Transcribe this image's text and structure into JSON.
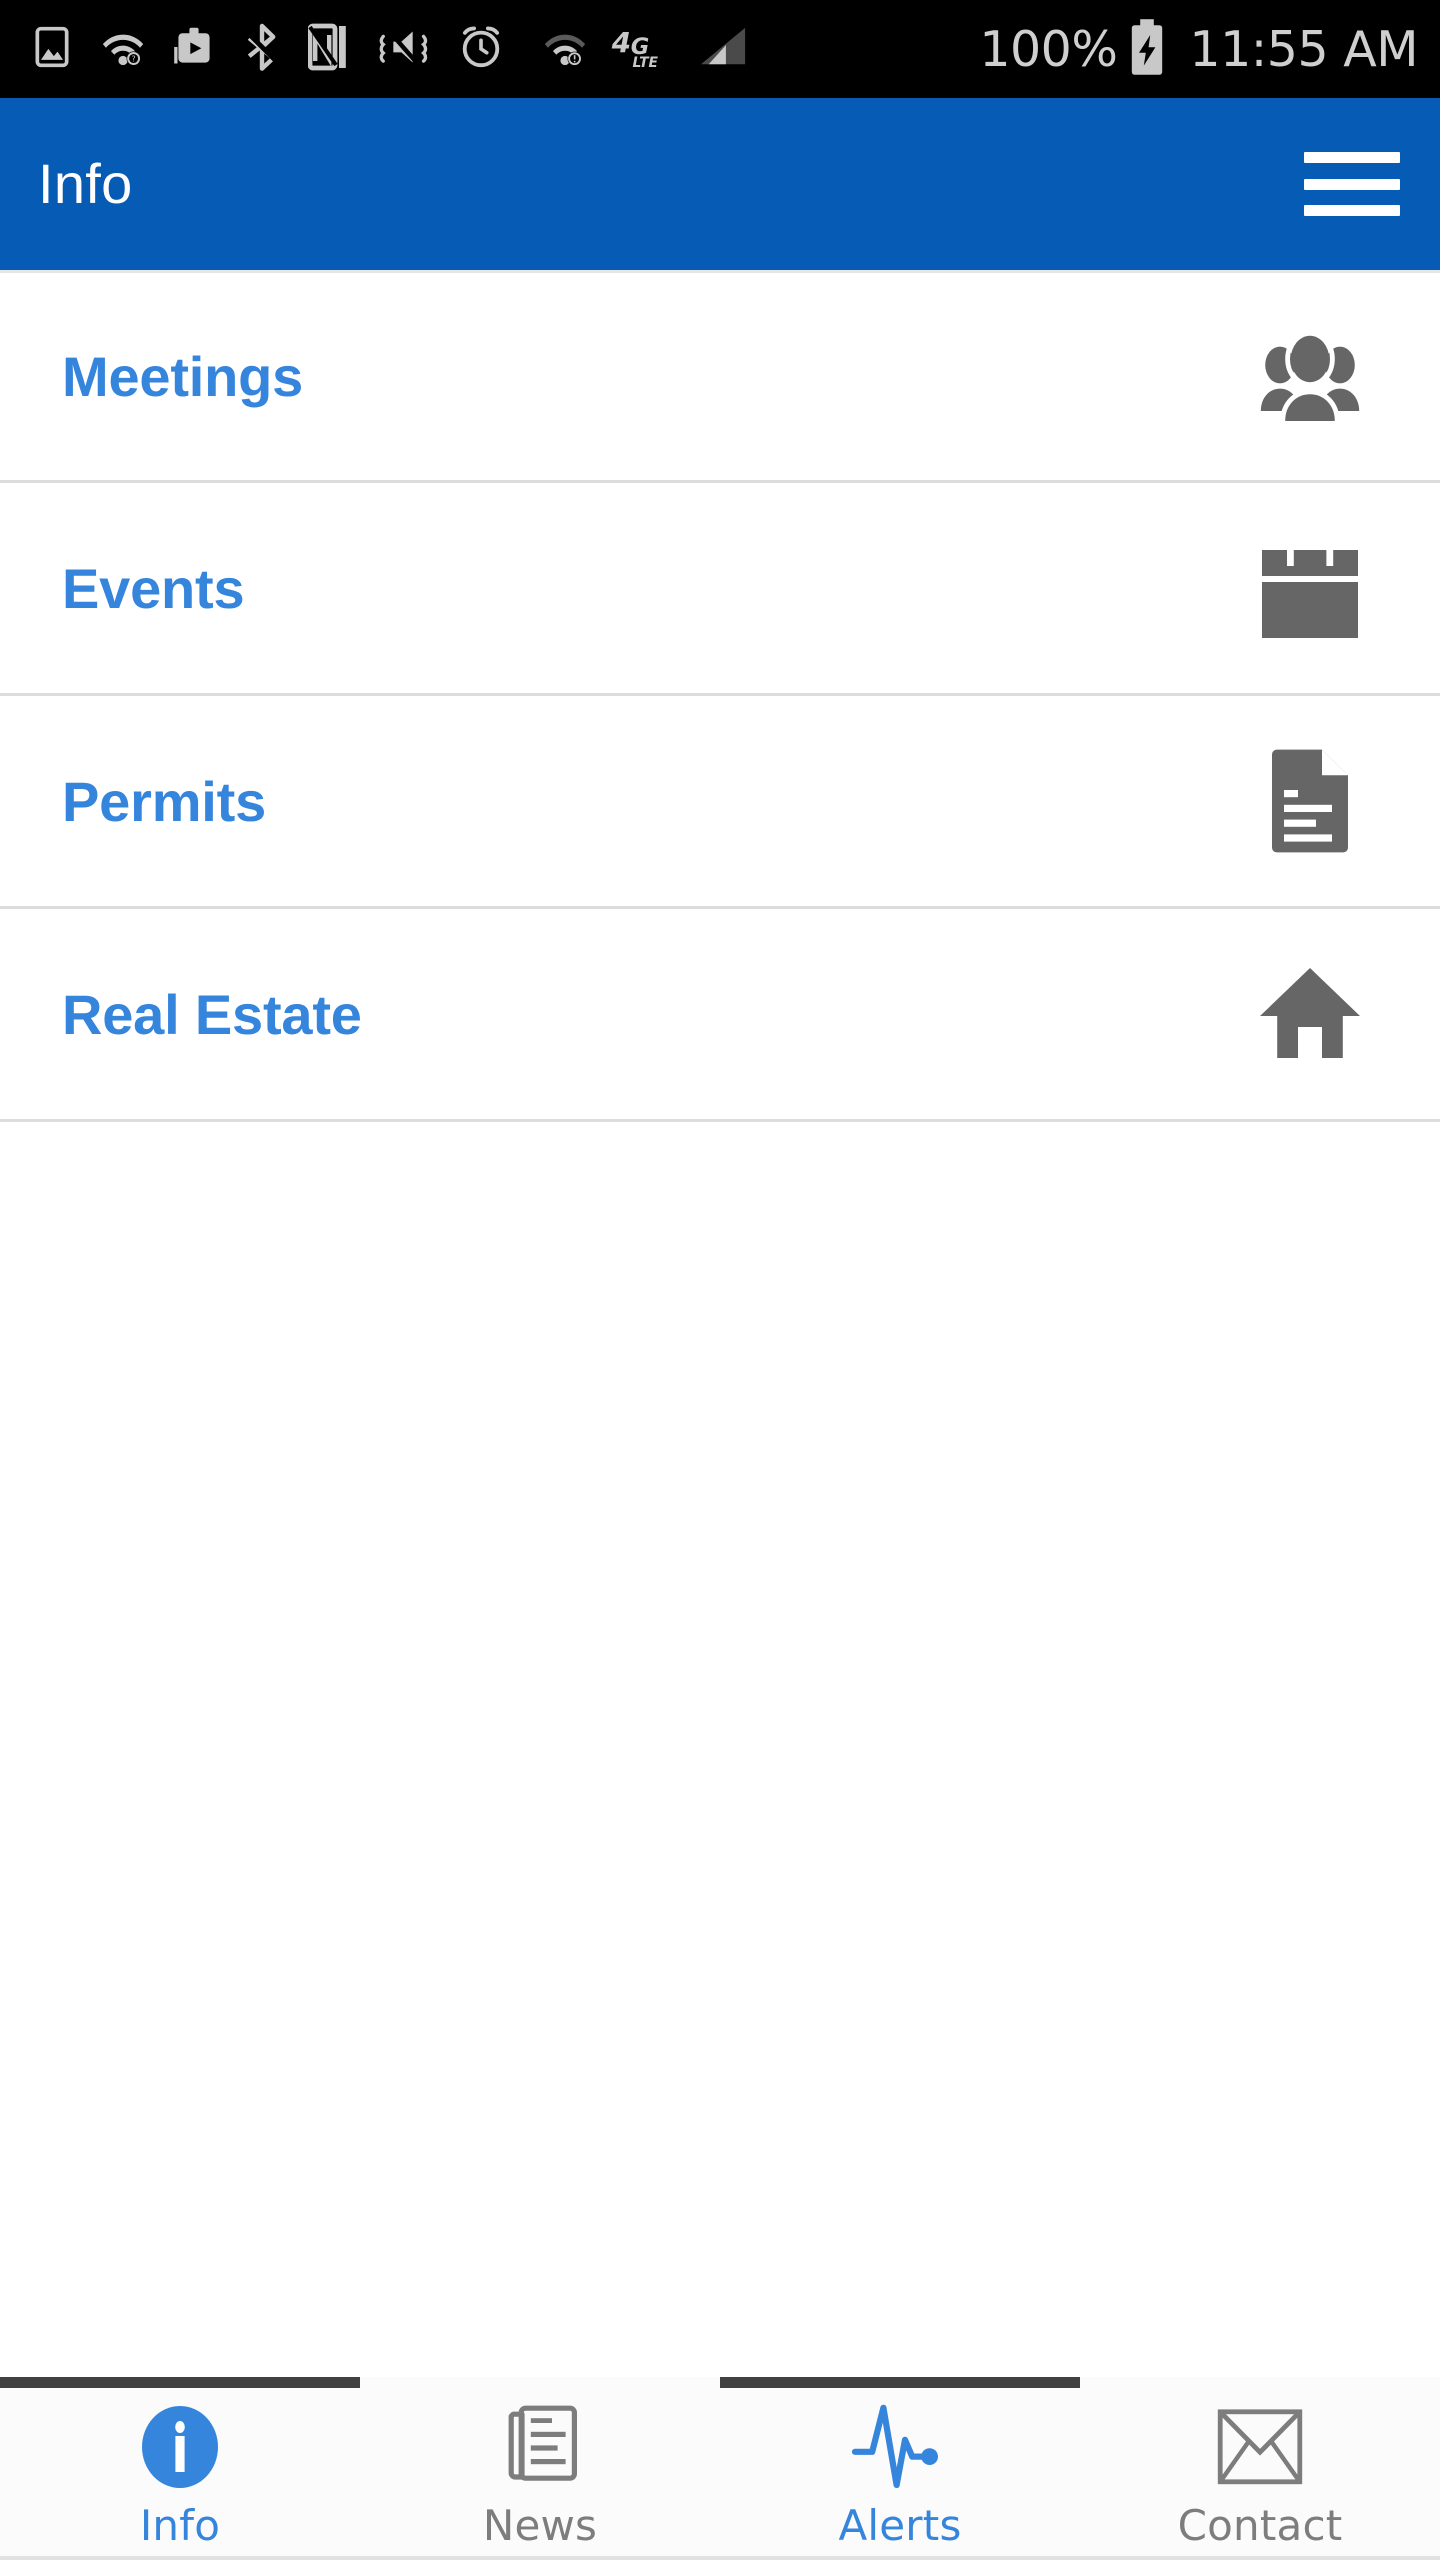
{
  "status_bar": {
    "icons": [
      {
        "name": "image-icon",
        "label": "Image"
      },
      {
        "name": "wifi-calling-icon",
        "label": "WiFi calling"
      },
      {
        "name": "screen-cast-icon",
        "label": "Screen cast"
      },
      {
        "name": "bluetooth-icon",
        "label": "Bluetooth"
      },
      {
        "name": "nfc-icon",
        "label": "NFC"
      },
      {
        "name": "vibrate-mute-icon",
        "label": "Vibrate / mute"
      },
      {
        "name": "alarm-icon",
        "label": "Alarm"
      },
      {
        "name": "wifi-icon",
        "label": "WiFi"
      },
      {
        "name": "4g-lte-icon",
        "label": "4G LTE"
      },
      {
        "name": "signal-bars-icon",
        "label": "Signal"
      }
    ],
    "network_label": "4G",
    "network_sublabel": "LTE",
    "battery_percent": "100%",
    "battery_state": "charging",
    "time": "11:55 AM"
  },
  "app_bar": {
    "title": "Info",
    "menu_icon": "hamburger-menu-icon",
    "background_color": "#065cb5",
    "text_color": "#ffffff"
  },
  "list": {
    "accent_color": "#3585dc",
    "icon_color": "#666666",
    "divider_color": "#dcdcdc",
    "items": [
      {
        "label": "Meetings",
        "icon": "people-group-icon"
      },
      {
        "label": "Events",
        "icon": "calendar-icon"
      },
      {
        "label": "Permits",
        "icon": "document-icon"
      },
      {
        "label": "Real Estate",
        "icon": "home-icon"
      }
    ]
  },
  "tab_bar": {
    "active_color": "#3585dc",
    "inactive_color": "#7d7d7d",
    "indicator_color": "#414141",
    "tabs": [
      {
        "label": "Info",
        "icon": "info-circle-icon",
        "active": true,
        "indicator": true
      },
      {
        "label": "News",
        "icon": "news-paper-icon",
        "active": false,
        "indicator": false
      },
      {
        "label": "Alerts",
        "icon": "pulse-wave-icon",
        "active": true,
        "indicator": true
      },
      {
        "label": "Contact",
        "icon": "envelope-icon",
        "active": false,
        "indicator": false
      }
    ]
  }
}
